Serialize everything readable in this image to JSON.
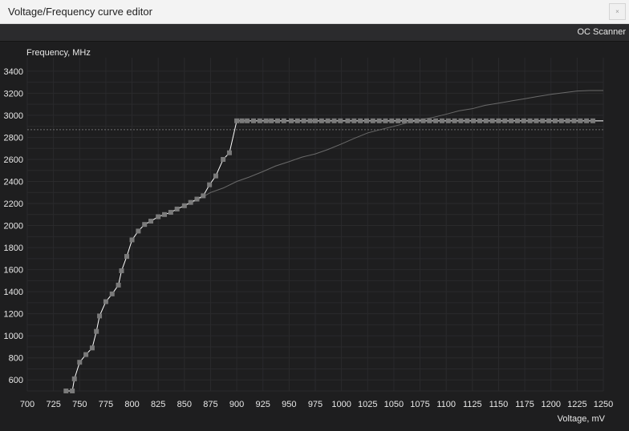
{
  "window": {
    "title": "Voltage/Frequency curve editor",
    "close_glyph": "×"
  },
  "toolbar": {
    "oc_scanner_label": "OC Scanner"
  },
  "chart_data": {
    "type": "line",
    "ylabel": "Frequency, MHz",
    "xlabel": "Voltage, mV",
    "xlim": [
      700,
      1250
    ],
    "ylim": [
      500,
      3450
    ],
    "x_ticks": [
      700,
      725,
      750,
      775,
      800,
      825,
      850,
      875,
      900,
      925,
      950,
      975,
      1000,
      1025,
      1050,
      1075,
      1100,
      1125,
      1150,
      1175,
      1200,
      1225,
      1250
    ],
    "y_ticks": [
      600,
      800,
      1000,
      1200,
      1400,
      1600,
      1800,
      2000,
      2200,
      2400,
      2600,
      2800,
      3000,
      3200,
      3400
    ],
    "grid": true,
    "colors": {
      "background": "#1e1e1f",
      "grid": "#2a2a2c",
      "curve": "#ffffff",
      "points": "#7a7a7a",
      "reference": "#707070",
      "text": "#e8e8e8"
    },
    "reference_line_y": 2870,
    "series": [
      {
        "role": "edited-curve",
        "points": [
          [
            737,
            500
          ],
          [
            743,
            500
          ],
          [
            745,
            610
          ],
          [
            750,
            760
          ],
          [
            756,
            830
          ],
          [
            762,
            890
          ],
          [
            766,
            1040
          ],
          [
            769,
            1180
          ],
          [
            775,
            1310
          ],
          [
            781,
            1380
          ],
          [
            787,
            1460
          ],
          [
            790,
            1590
          ],
          [
            795,
            1720
          ],
          [
            800,
            1870
          ],
          [
            806,
            1950
          ],
          [
            812,
            2010
          ],
          [
            818,
            2040
          ],
          [
            825,
            2080
          ],
          [
            831,
            2100
          ],
          [
            837,
            2120
          ],
          [
            843,
            2150
          ],
          [
            850,
            2180
          ],
          [
            856,
            2210
          ],
          [
            862,
            2240
          ],
          [
            868,
            2270
          ],
          [
            874,
            2370
          ],
          [
            880,
            2450
          ],
          [
            887,
            2600
          ],
          [
            893,
            2660
          ],
          [
            900,
            2950
          ],
          [
            1250,
            2950
          ]
        ]
      },
      {
        "role": "default-curve",
        "points": [
          [
            850,
            2180
          ],
          [
            862,
            2230
          ],
          [
            875,
            2300
          ],
          [
            887,
            2340
          ],
          [
            900,
            2400
          ],
          [
            912,
            2440
          ],
          [
            925,
            2490
          ],
          [
            937,
            2540
          ],
          [
            950,
            2580
          ],
          [
            962,
            2620
          ],
          [
            975,
            2650
          ],
          [
            987,
            2690
          ],
          [
            1000,
            2740
          ],
          [
            1012,
            2790
          ],
          [
            1025,
            2840
          ],
          [
            1037,
            2870
          ],
          [
            1050,
            2900
          ],
          [
            1062,
            2930
          ],
          [
            1075,
            2960
          ],
          [
            1087,
            2980
          ],
          [
            1100,
            3010
          ],
          [
            1112,
            3040
          ],
          [
            1125,
            3060
          ],
          [
            1137,
            3090
          ],
          [
            1150,
            3110
          ],
          [
            1162,
            3130
          ],
          [
            1175,
            3150
          ],
          [
            1187,
            3170
          ],
          [
            1200,
            3190
          ],
          [
            1212,
            3205
          ],
          [
            1225,
            3220
          ],
          [
            1237,
            3225
          ],
          [
            1250,
            3225
          ]
        ]
      }
    ],
    "flat_markers_x": [
      905,
      910,
      916,
      922,
      928,
      933,
      939,
      945,
      952,
      958,
      964,
      970,
      975,
      981,
      987,
      993,
      999,
      1006,
      1012,
      1018,
      1024,
      1030,
      1036,
      1042,
      1048,
      1054,
      1060,
      1066,
      1072,
      1078,
      1084,
      1090,
      1096,
      1102,
      1108,
      1114,
      1120,
      1126,
      1132,
      1138,
      1144,
      1150,
      1156,
      1162,
      1168,
      1174,
      1180,
      1186,
      1192,
      1198,
      1204,
      1210,
      1216,
      1222,
      1228,
      1234,
      1240
    ],
    "flat_markers_y": 2950
  }
}
